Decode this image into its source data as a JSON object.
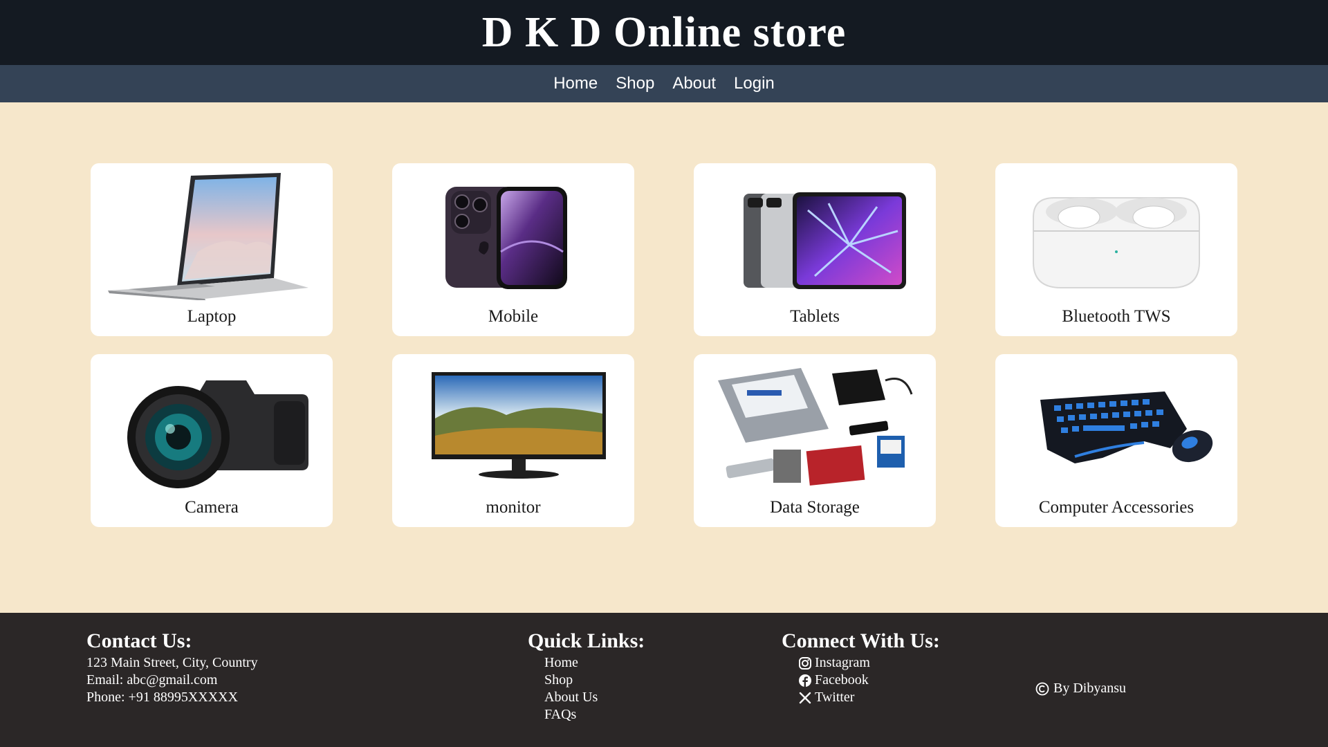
{
  "header": {
    "title": "D K D Online store"
  },
  "nav": {
    "items": [
      "Home",
      "Shop",
      "About",
      "Login"
    ]
  },
  "products": [
    {
      "label": "Laptop",
      "icon": "laptop-image"
    },
    {
      "label": "Mobile",
      "icon": "smartphone-image"
    },
    {
      "label": "Tablets",
      "icon": "tablet-image"
    },
    {
      "label": "Bluetooth TWS",
      "icon": "earbuds-image"
    },
    {
      "label": "Camera",
      "icon": "camera-image"
    },
    {
      "label": "monitor",
      "icon": "monitor-image"
    },
    {
      "label": "Data Storage",
      "icon": "storage-devices-image"
    },
    {
      "label": "Computer Accessories",
      "icon": "keyboard-mouse-image"
    }
  ],
  "footer": {
    "contact": {
      "heading": "Contact Us:",
      "address": "123 Main Street, City, Country",
      "email": "Email: abc@gmail.com",
      "phone": "Phone: +91 88995XXXXX"
    },
    "quick_links": {
      "heading": "Quick Links:",
      "items": [
        "Home",
        "Shop",
        "About Us",
        "FAQs"
      ]
    },
    "connect": {
      "heading": "Connect With Us:",
      "items": [
        {
          "label": "Instagram",
          "icon": "instagram-icon"
        },
        {
          "label": "Facebook",
          "icon": "facebook-icon"
        },
        {
          "label": "Twitter",
          "icon": "x-twitter-icon"
        }
      ]
    },
    "copyright": "By Dibyansu"
  },
  "colors": {
    "header_bg": "#141a22",
    "nav_bg": "#344356",
    "page_bg": "#f6e7cb",
    "card_bg": "#ffffff",
    "footer_bg": "#2b2727"
  }
}
